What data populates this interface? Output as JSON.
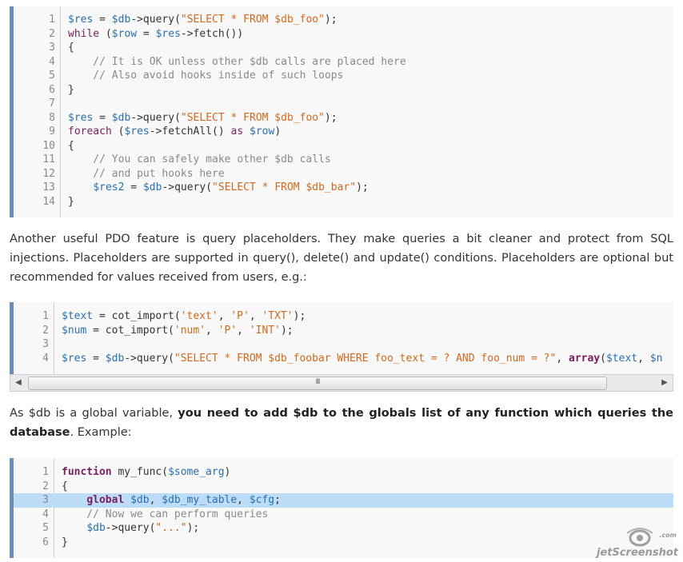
{
  "code_block_1": {
    "lines": [
      {
        "n": "1",
        "segs": [
          [
            "v",
            "$res"
          ],
          [
            "",
            "",
            " "
          ],
          [
            "",
            "",
            " "
          ]
        ]
      }
    ]
  },
  "block1": [
    [
      "1",
      [
        [
          "v",
          "$res"
        ],
        [
          "p",
          " = "
        ],
        [
          "v",
          "$db"
        ],
        [
          "p",
          "->query("
        ],
        [
          "s",
          "\"SELECT * FROM $db_foo\""
        ],
        [
          "p",
          ");"
        ]
      ]
    ],
    [
      "2",
      [
        [
          "k",
          "while"
        ],
        [
          "p",
          " ("
        ],
        [
          "v",
          "$row"
        ],
        [
          "p",
          " = "
        ],
        [
          "v",
          "$res"
        ],
        [
          "p",
          "->fetch())"
        ]
      ]
    ],
    [
      "3",
      [
        [
          "p",
          "{"
        ]
      ]
    ],
    [
      "4",
      [
        [
          "c",
          "    // It is OK unless other $db calls are placed here"
        ]
      ]
    ],
    [
      "5",
      [
        [
          "c",
          "    // Also avoid hooks inside of such loops"
        ]
      ]
    ],
    [
      "6",
      [
        [
          "p",
          "}"
        ]
      ]
    ],
    [
      "7",
      []
    ],
    [
      "8",
      [
        [
          "v",
          "$res"
        ],
        [
          "p",
          " = "
        ],
        [
          "v",
          "$db"
        ],
        [
          "p",
          "->query("
        ],
        [
          "s",
          "\"SELECT * FROM $db_foo\""
        ],
        [
          "p",
          ");"
        ]
      ]
    ],
    [
      "9",
      [
        [
          "k",
          "foreach"
        ],
        [
          "p",
          " ("
        ],
        [
          "v",
          "$res"
        ],
        [
          "p",
          "->fetchAll() "
        ],
        [
          "k",
          "as"
        ],
        [
          "p",
          " "
        ],
        [
          "v",
          "$row"
        ],
        [
          "p",
          ")"
        ]
      ]
    ],
    [
      "10",
      [
        [
          "p",
          "{"
        ]
      ]
    ],
    [
      "11",
      [
        [
          "c",
          "    // You can safely make other $db calls"
        ]
      ]
    ],
    [
      "12",
      [
        [
          "c",
          "    // and put hooks here"
        ]
      ]
    ],
    [
      "13",
      [
        [
          "p",
          "    "
        ],
        [
          "v",
          "$res2"
        ],
        [
          "p",
          " = "
        ],
        [
          "v",
          "$db"
        ],
        [
          "p",
          "->query("
        ],
        [
          "s",
          "\"SELECT * FROM $db_bar\""
        ],
        [
          "p",
          ");"
        ]
      ]
    ],
    [
      "14",
      [
        [
          "p",
          "}"
        ]
      ]
    ]
  ],
  "paragraph_1": "Another useful PDO feature is query placeholders. They make queries a bit cleaner and protect from SQL injections. Placeholders are supported in query(), delete() and update() conditions. Placeholders are optional but recommended for values received from users, e.g.:",
  "block2": [
    [
      "1",
      [
        [
          "v",
          "$text"
        ],
        [
          "p",
          " = cot_import("
        ],
        [
          "s",
          "'text'"
        ],
        [
          "p",
          ", "
        ],
        [
          "s",
          "'P'"
        ],
        [
          "p",
          ", "
        ],
        [
          "s",
          "'TXT'"
        ],
        [
          "p",
          ");"
        ]
      ]
    ],
    [
      "2",
      [
        [
          "v",
          "$num"
        ],
        [
          "p",
          " = cot_import("
        ],
        [
          "s",
          "'num'"
        ],
        [
          "p",
          ", "
        ],
        [
          "s",
          "'P'"
        ],
        [
          "p",
          ", "
        ],
        [
          "s",
          "'INT'"
        ],
        [
          "p",
          ");"
        ]
      ]
    ],
    [
      "3",
      []
    ],
    [
      "4",
      [
        [
          "v",
          "$res"
        ],
        [
          "p",
          " = "
        ],
        [
          "v",
          "$db"
        ],
        [
          "p",
          "->query("
        ],
        [
          "s",
          "\"SELECT * FROM $db_foobar WHERE foo_text = ? AND foo_num = ?\""
        ],
        [
          "p",
          ", "
        ],
        [
          "kb",
          "array"
        ],
        [
          "p",
          "("
        ],
        [
          "v",
          "$text"
        ],
        [
          "p",
          ", "
        ],
        [
          "v",
          "$n"
        ]
      ]
    ]
  ],
  "scrollbar": {
    "left_arrow": "◀",
    "right_arrow": "▶",
    "grip": "III"
  },
  "paragraph_2": {
    "pre": "As $db is a global variable, ",
    "bold": "you need to add $db to the globals list of any function which queries the database",
    "post": ". Example:"
  },
  "block3": [
    [
      "1",
      [
        [
          "kb",
          "function"
        ],
        [
          "p",
          " my_func("
        ],
        [
          "v",
          "$some_arg"
        ],
        [
          "p",
          ")"
        ]
      ]
    ],
    [
      "2",
      [
        [
          "p",
          "{"
        ]
      ]
    ],
    [
      "3",
      [
        [
          "p",
          "    "
        ],
        [
          "kb",
          "global"
        ],
        [
          "p",
          " "
        ],
        [
          "v",
          "$db"
        ],
        [
          "p",
          ", "
        ],
        [
          "v",
          "$db_my_table"
        ],
        [
          "p",
          ", "
        ],
        [
          "v",
          "$cfg"
        ],
        [
          "p",
          ";"
        ]
      ]
    ],
    [
      "4",
      [
        [
          "c",
          "    // Now we can perform queries"
        ]
      ]
    ],
    [
      "5",
      [
        [
          "p",
          "    "
        ],
        [
          "v",
          "$db"
        ],
        [
          "p",
          "->query("
        ],
        [
          "s",
          "\"...\""
        ],
        [
          "p",
          ");"
        ]
      ]
    ],
    [
      "6",
      [
        [
          "p",
          "}"
        ]
      ]
    ]
  ],
  "block3_highlight_line": "3",
  "watermark": {
    "text": "jetScreenshot",
    "sub": ".com"
  },
  "colors": {
    "accent_border": "#6d8db4",
    "highlight": "#bcdcf7",
    "keyword": "#7a1f5c",
    "variable": "#2a6fb0",
    "string": "#d2691e",
    "comment": "#8a8a8a"
  }
}
